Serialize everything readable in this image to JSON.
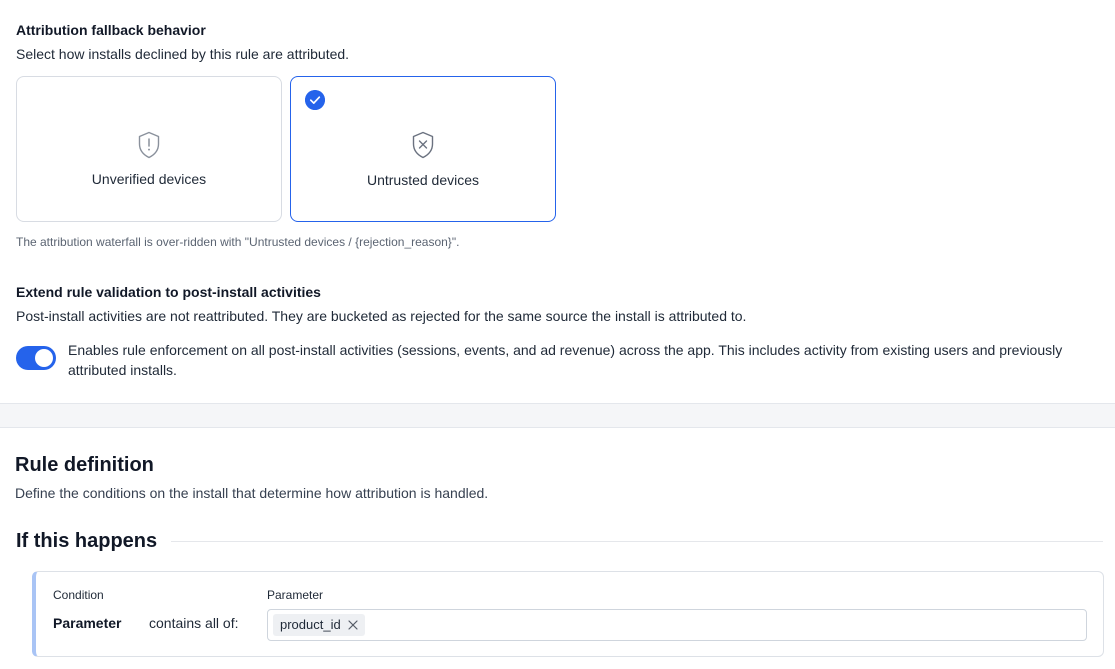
{
  "fallback": {
    "title": "Attribution fallback behavior",
    "description": "Select how installs declined by this rule are attributed.",
    "options": [
      {
        "label": "Unverified devices",
        "icon": "shield-exclamation-icon",
        "selected": false
      },
      {
        "label": "Untrusted devices",
        "icon": "shield-x-icon",
        "selected": true
      }
    ],
    "note": "The attribution waterfall is over-ridden with \"Untrusted devices / {rejection_reason}\"."
  },
  "extend": {
    "title": "Extend rule validation to post-install activities",
    "description": "Post-install activities are not reattributed. They are bucketed as rejected for the same source the install is attributed to.",
    "toggle_on": true,
    "toggle_text": "Enables rule enforcement on all post-install activities (sessions, events, and ad revenue) across the app. This includes activity from existing users and previously attributed installs."
  },
  "rule": {
    "title": "Rule definition",
    "description": "Define the conditions on the install that determine how attribution is handled.",
    "if_title": "If this happens",
    "condition": {
      "condition_header": "Condition",
      "parameter_header": "Parameter",
      "field": "Parameter",
      "operator": "contains all of:",
      "chips": [
        "product_id"
      ]
    }
  },
  "colors": {
    "accent": "#2563eb",
    "card_border": "#d8dce3",
    "condition_bar": "#a9c4f5"
  }
}
